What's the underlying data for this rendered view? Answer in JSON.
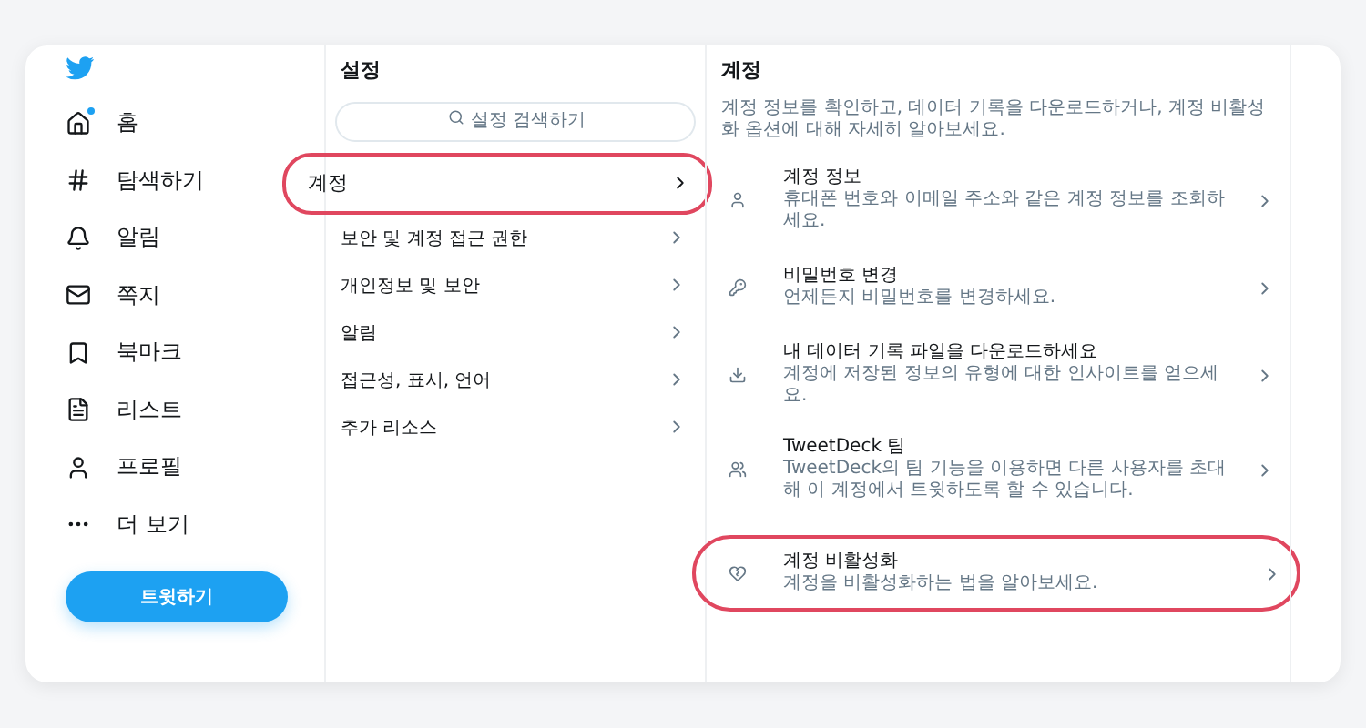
{
  "nav": {
    "items": [
      {
        "label": "홈",
        "badge": true
      },
      {
        "label": "탐색하기",
        "badge": false
      },
      {
        "label": "알림",
        "badge": false
      },
      {
        "label": "쪽지",
        "badge": false
      },
      {
        "label": "북마크",
        "badge": false
      },
      {
        "label": "리스트",
        "badge": false
      },
      {
        "label": "프로필",
        "badge": false
      },
      {
        "label": "더 보기",
        "badge": false
      }
    ],
    "tweet_button": "트윗하기"
  },
  "settings": {
    "title": "설정",
    "search": {
      "placeholder": "설정 검색하기"
    },
    "items": [
      {
        "label": "계정",
        "selected": true
      },
      {
        "label": "보안 및 계정 접근 권한",
        "selected": false
      },
      {
        "label": "개인정보 및 보안",
        "selected": false
      },
      {
        "label": "알림",
        "selected": false
      },
      {
        "label": "접근성, 표시, 언어",
        "selected": false
      },
      {
        "label": "추가 리소스",
        "selected": false
      }
    ]
  },
  "account": {
    "title": "계정",
    "description": "계정 정보를 확인하고, 데이터 기록을 다운로드하거나, 계정 비활성화 옵션에 대해 자세히 알아보세요.",
    "items": [
      {
        "title": "계정 정보",
        "subtitle": "휴대폰 번호와 이메일 주소와 같은 계정 정보를 조회하세요.",
        "highlighted": false
      },
      {
        "title": "비밀번호 변경",
        "subtitle": "언제든지 비밀번호를 변경하세요.",
        "highlighted": false
      },
      {
        "title": "내 데이터 기록 파일을 다운로드하세요",
        "subtitle": "계정에 저장된 정보의 유형에 대한 인사이트를 얻으세요.",
        "highlighted": false
      },
      {
        "title": "TweetDeck 팀",
        "subtitle": "TweetDeck의 팀 기능을 이용하면 다른 사용자를 초대해 이 계정에서 트윗하도록 할 수 있습니다.",
        "highlighted": false
      },
      {
        "title": "계정 비활성화",
        "subtitle": "계정을 비활성화하는 법을 알아보세요.",
        "highlighted": true
      }
    ]
  }
}
